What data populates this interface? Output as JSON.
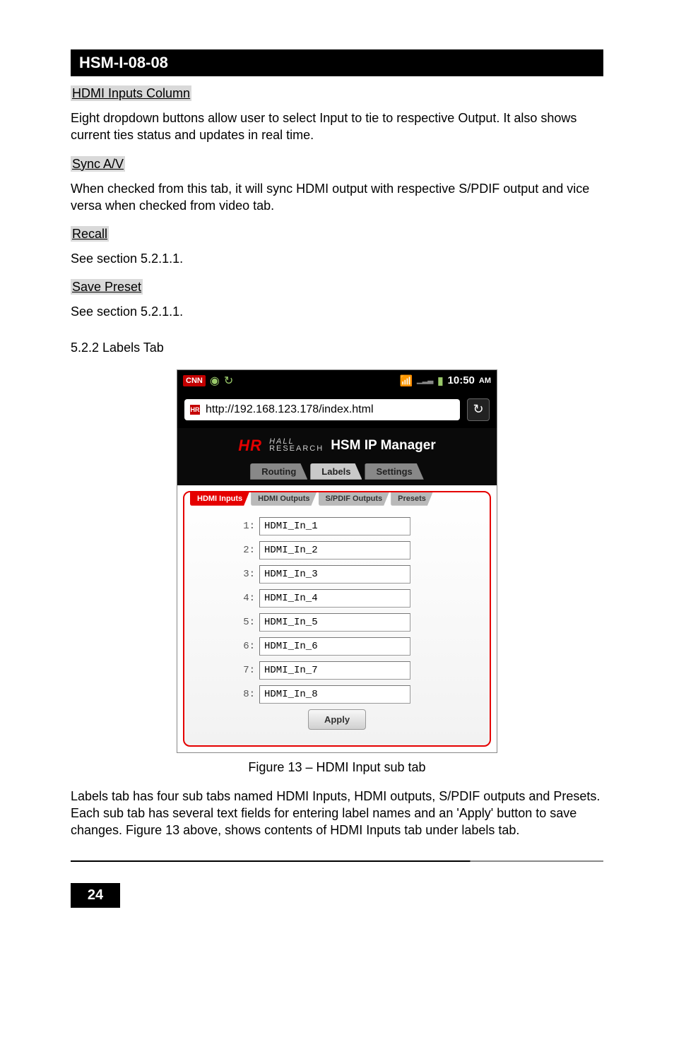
{
  "doc": {
    "title": "HSM-I-08-08",
    "sections": {
      "hdmi_inputs_column": {
        "label": "HDMI Inputs Column",
        "text": "Eight dropdown buttons allow user to select Input to tie to respective Output. It also shows current ties status and updates in real time."
      },
      "sync_av": {
        "label": "Sync A/V",
        "text": "When checked from this tab, it will sync HDMI output with respective S/PDIF output and vice versa when checked from video tab."
      },
      "recall": {
        "label": "Recall",
        "text": "See section 5.2.1.1."
      },
      "save_preset": {
        "label": "Save Preset",
        "text": "See section 5.2.1.1."
      }
    },
    "labels_heading": "5.2.2 Labels Tab",
    "figure_caption": "Figure 13 – HDMI Input sub tab",
    "bottom_para": "Labels tab has four sub tabs named HDMI Inputs, HDMI outputs, S/PDIF outputs and Presets. Each sub tab has several text fields for entering label names and an 'Apply' button to save changes.  Figure 13 above, shows contents of HDMI Inputs tab under labels tab.",
    "page_number": "24"
  },
  "screenshot": {
    "status": {
      "cnn": "CNN",
      "time": "10:50",
      "ampm": "AM"
    },
    "url": "http://192.168.123.178/index.html",
    "brand": {
      "logo": "HR",
      "sub1": "HALL",
      "sub2": "RESEARCH",
      "title": "HSM IP Manager"
    },
    "main_tabs": [
      "Routing",
      "Labels",
      "Settings"
    ],
    "sub_tabs": [
      "HDMI Inputs",
      "HDMI Outputs",
      "S/PDIF Outputs",
      "Presets"
    ],
    "fields": [
      {
        "idx": "1:",
        "val": "HDMI_In_1"
      },
      {
        "idx": "2:",
        "val": "HDMI_In_2"
      },
      {
        "idx": "3:",
        "val": "HDMI_In_3"
      },
      {
        "idx": "4:",
        "val": "HDMI_In_4"
      },
      {
        "idx": "5:",
        "val": "HDMI_In_5"
      },
      {
        "idx": "6:",
        "val": "HDMI_In_6"
      },
      {
        "idx": "7:",
        "val": "HDMI_In_7"
      },
      {
        "idx": "8:",
        "val": "HDMI_In_8"
      }
    ],
    "apply": "Apply"
  }
}
